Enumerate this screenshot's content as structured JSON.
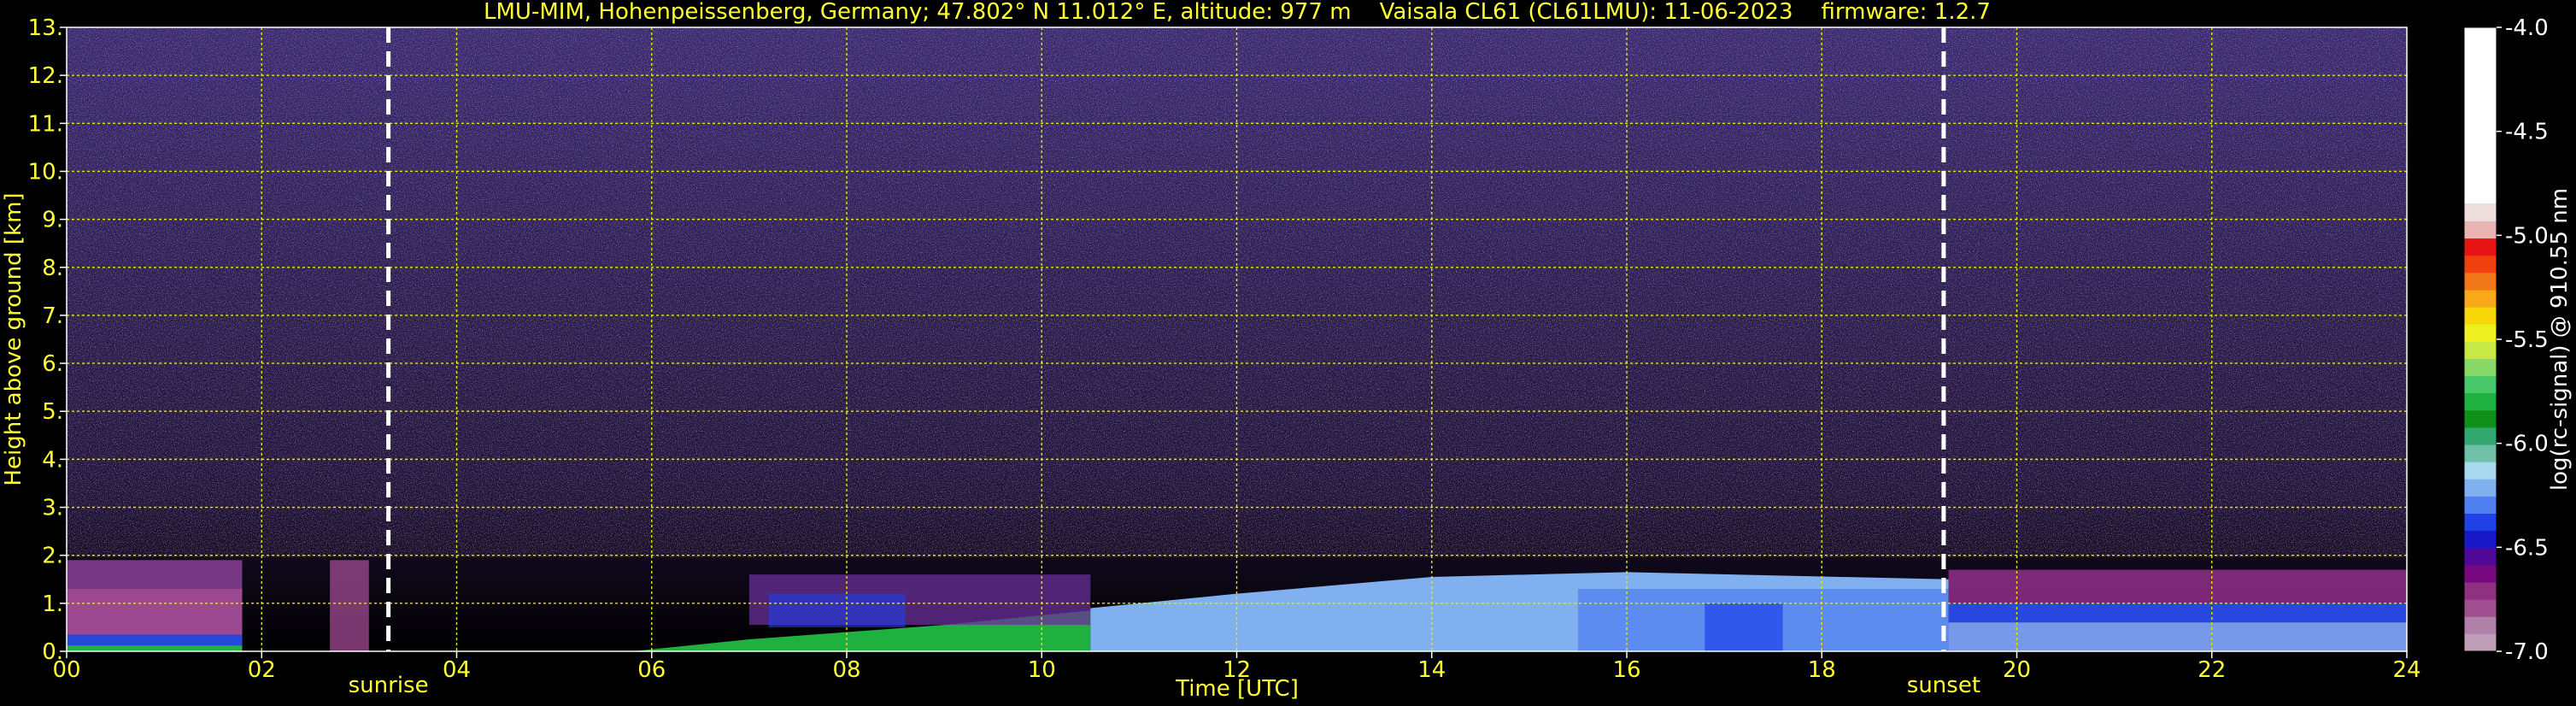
{
  "chart_data": {
    "type": "heatmap",
    "title": "LMU-MIM, Hohenpeissenberg, Germany; 47.802° N 11.012° E, altitude: 977 m    Vaisala CL61 (CL61LMU): 11-06-2023    firmware: 1.2.7",
    "xlabel": "Time [UTC]",
    "ylabel": "Height above ground [km]",
    "xlim": [
      0,
      24
    ],
    "ylim": [
      0,
      13
    ],
    "x_ticks": [
      "00",
      "02",
      "04",
      "06",
      "08",
      "10",
      "12",
      "14",
      "16",
      "18",
      "20",
      "22",
      "24"
    ],
    "y_ticks": [
      "0.",
      "1.",
      "2.",
      "3.",
      "4.",
      "5.",
      "6.",
      "7.",
      "8.",
      "9.",
      "10.",
      "11.",
      "12.",
      "13."
    ],
    "grid": true,
    "annotations": [
      {
        "label": "sunrise",
        "x": 3.3
      },
      {
        "label": "sunset",
        "x": 19.25
      }
    ],
    "colorbar": {
      "label": "log(rc-signal) @ 910.55 nm",
      "range": [
        -7.0,
        -4.0
      ],
      "ticks": [
        "-4.0",
        "-4.5",
        "-5.0",
        "-5.5",
        "-6.0",
        "-6.5",
        "-7.0"
      ],
      "colors": [
        "#ffffff",
        "#efdede",
        "#e9b4b4",
        "#e81313",
        "#f04010",
        "#f07818",
        "#f8a818",
        "#f8d808",
        "#eef020",
        "#c8e848",
        "#88d868",
        "#48c868",
        "#20b040",
        "#109018",
        "#30a870",
        "#70c0a8",
        "#a8d8f0",
        "#80b0f0",
        "#5080f0",
        "#2040e8",
        "#1818c8",
        "#500898",
        "#780880",
        "#903080",
        "#a05090",
        "#b080a8",
        "#c0a0b8"
      ]
    },
    "layers": [
      {
        "name": "noise",
        "height_range": [
          2.0,
          13.0
        ],
        "value": -6.5
      },
      {
        "name": "boundary_layer_night",
        "time_range": [
          0,
          1.8
        ],
        "height_range": [
          0,
          1.9
        ],
        "value": -6.3
      },
      {
        "name": "residual_layer",
        "time_range": [
          7.0,
          24
        ],
        "height_range": [
          0,
          1.6
        ],
        "value": -6.2
      },
      {
        "name": "convective_layer",
        "time_range": [
          10.5,
          19.3
        ],
        "height_range": [
          0,
          1.7
        ],
        "value": -6.0
      }
    ]
  }
}
